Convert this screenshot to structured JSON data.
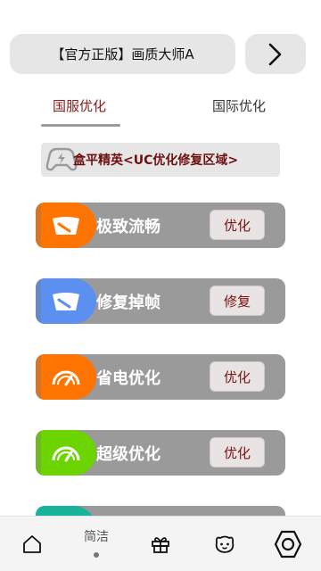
{
  "header": {
    "title": "【官方正版】画质大师A",
    "next_icon": "chevron-right-icon"
  },
  "tabs": [
    {
      "label": "国服优化",
      "active": true
    },
    {
      "label": "国际优化",
      "active": false
    }
  ],
  "region": {
    "icon": "gamepad-lightning-icon",
    "label": "盒平精英<UC优化修复区域>"
  },
  "modes": [
    {
      "label": "极致流畅",
      "action": "优化",
      "color": "#ff7300",
      "icon": "speed-gauge-icon"
    },
    {
      "label": "修复掉帧",
      "action": "修复",
      "color": "#5b8ff0",
      "icon": "speed-gauge-icon"
    },
    {
      "label": "省电优化",
      "action": "优化",
      "color": "#ff7300",
      "icon": "meter-icon"
    },
    {
      "label": "超级优化",
      "action": "优化",
      "color": "#6cd400",
      "icon": "meter-icon"
    },
    {
      "label": "",
      "action": "",
      "color": "#17b39a",
      "icon": ""
    }
  ],
  "bottom_nav": {
    "items": [
      {
        "name": "home",
        "icon": "home-icon"
      },
      {
        "name": "clean",
        "label": "简洁",
        "icon": "dot-indicator"
      },
      {
        "name": "gift",
        "icon": "gift-icon"
      },
      {
        "name": "face",
        "icon": "face-icon"
      },
      {
        "name": "settings",
        "icon": "settings-hexagon-icon"
      }
    ]
  }
}
